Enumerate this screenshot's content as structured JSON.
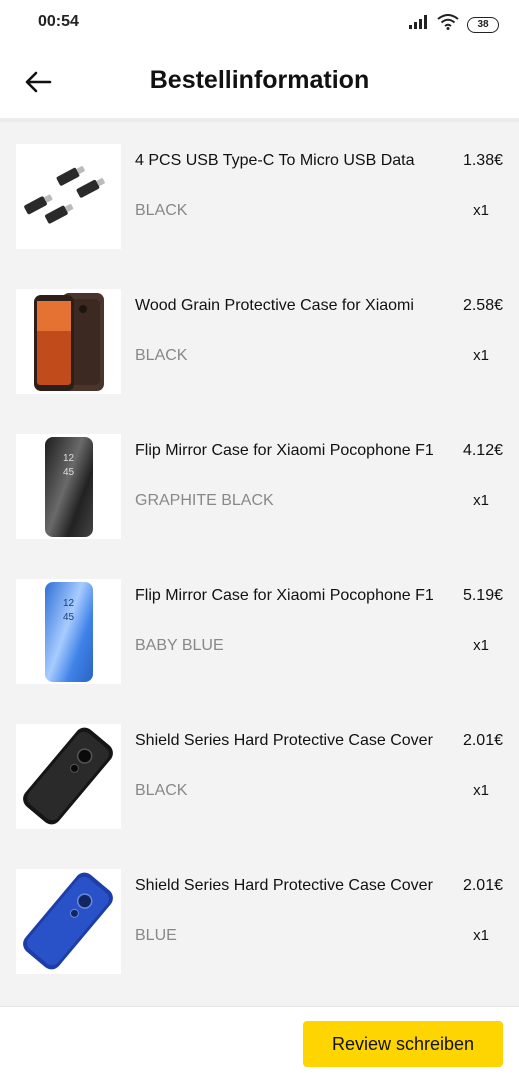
{
  "status_bar": {
    "time": "00:54",
    "battery": "38"
  },
  "header": {
    "title": "Bestellinformation"
  },
  "items": [
    {
      "name": "4 PCS USB Type-C To Micro USB Data",
      "variant": "BLACK",
      "price": "1.38€",
      "qty": "x1",
      "image": "usb-adapter-image"
    },
    {
      "name": "Wood Grain Protective Case for Xiaomi",
      "variant": "BLACK",
      "price": "2.58€",
      "qty": "x1",
      "image": "wood-case-image"
    },
    {
      "name": "Flip Mirror Case for Xiaomi Pocophone F1",
      "variant": "GRAPHITE BLACK",
      "price": "4.12€",
      "qty": "x1",
      "image": "mirror-case-black-image"
    },
    {
      "name": "Flip Mirror Case for Xiaomi Pocophone F1",
      "variant": "BABY BLUE",
      "price": "5.19€",
      "qty": "x1",
      "image": "mirror-case-blue-image"
    },
    {
      "name": "Shield Series Hard Protective Case Cover",
      "variant": "BLACK",
      "price": "2.01€",
      "qty": "x1",
      "image": "shield-case-black-image"
    },
    {
      "name": "Shield Series Hard Protective Case Cover",
      "variant": "BLUE",
      "price": "2.01€",
      "qty": "x1",
      "image": "shield-case-blue-image"
    }
  ],
  "mirror_clock_black": {
    "h": "12",
    "m": "45"
  },
  "mirror_clock_blue": {
    "h": "12",
    "m": "45"
  },
  "footer": {
    "review_button": "Review schreiben"
  },
  "colors": {
    "accent": "#ffd500",
    "background": "#f3f3f3",
    "secondary_text": "#888888"
  }
}
